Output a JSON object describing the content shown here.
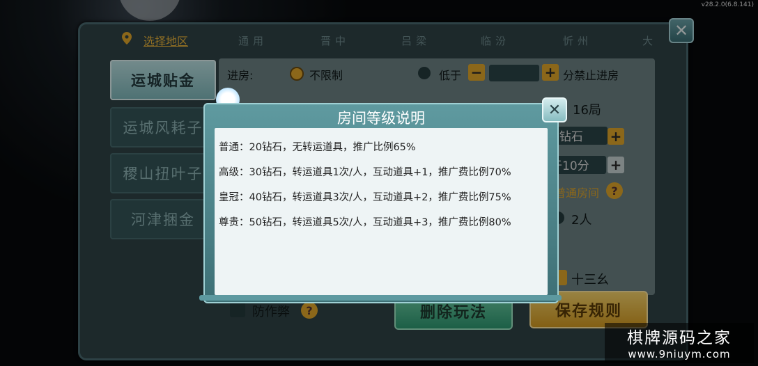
{
  "version": "v28.2.0(6.8.141)",
  "region": {
    "label": "选择地区"
  },
  "tabs": [
    "通用",
    "晋中",
    "吕梁",
    "临汾",
    "忻州",
    "大"
  ],
  "games": [
    {
      "label": "运城贴金",
      "active": true
    },
    {
      "label": "运城风耗子",
      "active": false
    },
    {
      "label": "稷山扭叶子",
      "active": false
    },
    {
      "label": "河津捆金",
      "active": false
    }
  ],
  "settings": {
    "entry_label": "进房:",
    "unlimited": "不限制",
    "below": "低于",
    "forbid_suffix": "分禁止进房",
    "rounds": "16局",
    "diamonds_partial": "0钻石",
    "below10": "于10分",
    "normal_room": "普通房间",
    "two_players": "2人",
    "thirteen": "十三幺",
    "anti_cheat": "防作弊"
  },
  "buttons": {
    "delete": "删除玩法",
    "save": "保存规则"
  },
  "modal": {
    "title": "房间等级说明",
    "rules": [
      "普通：20钻石，无转运道具，推广比例65%",
      "高级：30钻石，转运道具1次/人，互动道具+1，推广费比例70%",
      "皇冠：40钻石，转运道具3次/人，互动道具+2，推广费比例75%",
      "尊贵：50钻石，转运道具5次/人，互动道具+3，推广费比例80%"
    ]
  },
  "watermark": {
    "line1": "棋牌源码之家",
    "line2": "www.9niuym.com"
  },
  "colors": {
    "accent": "#e0a62b",
    "panel": "#2f4346",
    "modal": "#5f9aa0"
  },
  "icons": {
    "close": "close-icon",
    "pin": "location-pin-icon",
    "plus": "plus-icon",
    "minus": "minus-icon",
    "help": "question-icon"
  }
}
